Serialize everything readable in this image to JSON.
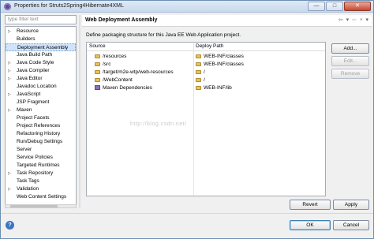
{
  "window": {
    "title": "Properties for Struts2Spring4Hibernate4XML",
    "buttons": {
      "minimize": "—",
      "maximize": "□",
      "close": "✕"
    }
  },
  "filter": {
    "placeholder": "type filter text"
  },
  "tree": [
    {
      "label": "Resource",
      "expandable": true
    },
    {
      "label": "Builders",
      "expandable": false
    },
    {
      "label": "Deployment Assembly",
      "expandable": false,
      "selected": true
    },
    {
      "label": "Java Build Path",
      "expandable": false
    },
    {
      "label": "Java Code Style",
      "expandable": true
    },
    {
      "label": "Java Compiler",
      "expandable": true
    },
    {
      "label": "Java Editor",
      "expandable": true
    },
    {
      "label": "Javadoc Location",
      "expandable": false
    },
    {
      "label": "JavaScript",
      "expandable": true
    },
    {
      "label": "JSP Fragment",
      "expandable": false
    },
    {
      "label": "Maven",
      "expandable": true
    },
    {
      "label": "Project Facets",
      "expandable": false
    },
    {
      "label": "Project References",
      "expandable": false
    },
    {
      "label": "Refactoring History",
      "expandable": false
    },
    {
      "label": "Run/Debug Settings",
      "expandable": false
    },
    {
      "label": "Server",
      "expandable": false
    },
    {
      "label": "Service Policies",
      "expandable": false
    },
    {
      "label": "Targeted Runtimes",
      "expandable": false
    },
    {
      "label": "Task Repository",
      "expandable": true
    },
    {
      "label": "Task Tags",
      "expandable": false
    },
    {
      "label": "Validation",
      "expandable": true
    },
    {
      "label": "Web Content Settings",
      "expandable": false
    }
  ],
  "page": {
    "title": "Web Deployment Assembly",
    "description": "Define packaging structure for this Java EE Web Application project."
  },
  "table": {
    "columns": [
      "Source",
      "Deploy Path"
    ],
    "rows": [
      {
        "source": "/resources",
        "deploy": "WEB-INF/classes",
        "icon": "folder-icon"
      },
      {
        "source": "/src",
        "deploy": "WEB-INF/classes",
        "icon": "folder-icon"
      },
      {
        "source": "/target/m2e-wtp/web-resources",
        "deploy": "/",
        "icon": "folder-icon"
      },
      {
        "source": "/WebContent",
        "deploy": "/",
        "icon": "folder-icon"
      },
      {
        "source": "Maven Dependencies",
        "deploy": "WEB-INF/lib",
        "icon": "library-icon"
      }
    ],
    "watermark": "http://blog.csdn.net/"
  },
  "buttons": {
    "add": "Add...",
    "edit": "Edit...",
    "remove": "Remove",
    "revert": "Revert",
    "apply": "Apply",
    "ok": "OK",
    "cancel": "Cancel"
  },
  "icons": {
    "help": "?"
  }
}
